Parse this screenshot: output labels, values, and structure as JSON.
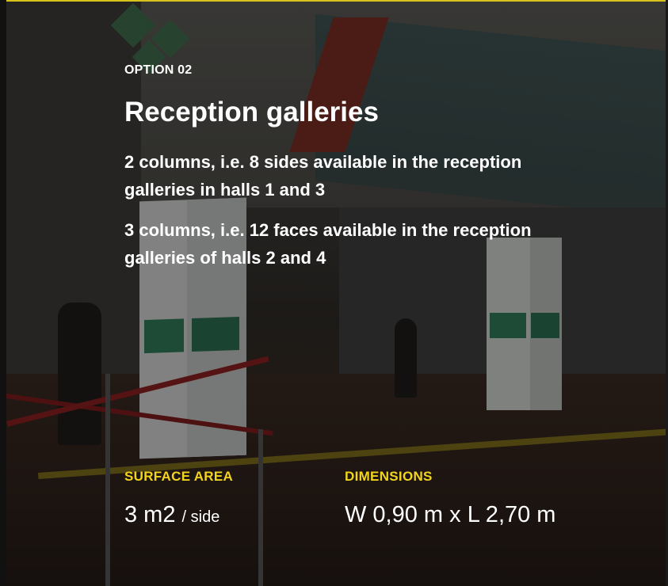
{
  "option_label": "OPTION 02",
  "title": "Reception galleries",
  "paragraphs": [
    "2 columns, i.e. 8 sides available in the reception galleries in halls 1 and 3",
    "3 columns, i.e. 12 faces available in the reception galleries of halls 2 and 4"
  ],
  "specs": {
    "surface": {
      "label": "SURFACE AREA",
      "value": "3 m2",
      "unit": "/ side"
    },
    "dimensions": {
      "label": "DIMENSIONS",
      "value": "W 0,90 m x L 2,70 m"
    }
  },
  "colors": {
    "accent": "#f3d41d",
    "text": "#ffffff"
  }
}
